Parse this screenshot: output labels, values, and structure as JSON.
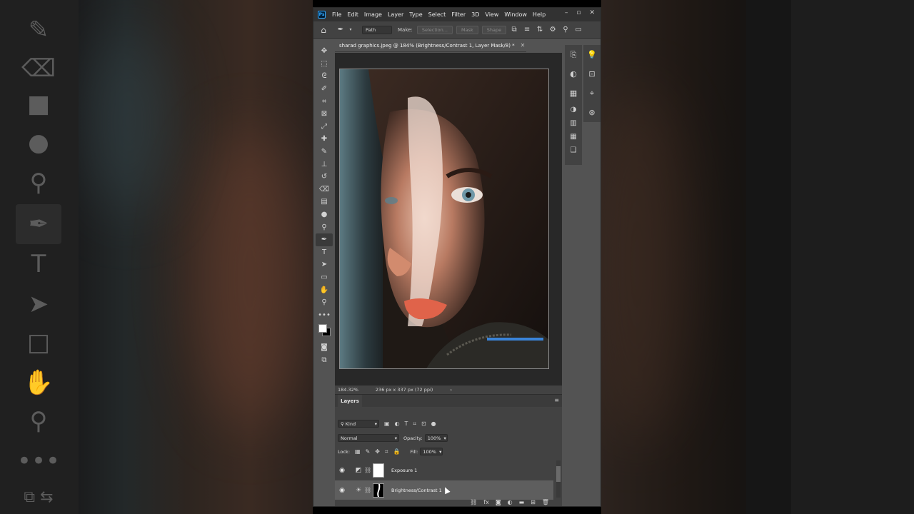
{
  "app": {
    "logo": "Ps",
    "menu": [
      "File",
      "Edit",
      "Image",
      "Layer",
      "Type",
      "Select",
      "Filter",
      "3D",
      "View",
      "Window",
      "Help"
    ],
    "window_controls": [
      "minimize-icon",
      "maximize-icon",
      "close-icon"
    ]
  },
  "options_bar": {
    "mode_value": "Path",
    "make_label": "Make:",
    "selection_btn": "Selection...",
    "mask_btn": "Mask",
    "shape_btn": "Shape"
  },
  "toolbar": {
    "tools": [
      "move-icon",
      "marquee-icon",
      "lasso-icon",
      "quick-select-icon",
      "crop-icon",
      "frame-icon",
      "eyedropper-icon",
      "healing-icon",
      "brush-icon",
      "stamp-icon",
      "history-brush-icon",
      "eraser-icon",
      "gradient-icon",
      "blur-icon",
      "dodge-icon",
      "pen-icon",
      "type-icon",
      "path-select-icon",
      "rectangle-icon",
      "hand-icon",
      "zoom-icon",
      "more-icon"
    ],
    "selected": "pen-icon",
    "foreground": "#ffffff",
    "background": "#000000"
  },
  "document": {
    "tab_title": "sharad graphics.jpeg @ 184% (Brightness/Contrast 1, Layer Mask/8) *",
    "zoom": "184.32%",
    "dimensions": "236 px x 337 px (72 ppi)",
    "accent_line_color": "#3a84d8"
  },
  "right_panels": {
    "column1": [
      "history-icon",
      "color-icon",
      "swatches-icon",
      "adjustments-icon",
      "gradients-icon",
      "patterns-icon",
      "libraries-icon"
    ],
    "column2": [
      "learn-icon",
      "properties-icon",
      "paths-icon",
      "channels-icon"
    ]
  },
  "layers": {
    "tab": "Layers",
    "filter_kind": "Kind",
    "blend_mode": "Normal",
    "opacity_label": "Opacity:",
    "opacity_value": "100%",
    "lock_label": "Lock:",
    "fill_label": "Fill:",
    "fill_value": "100%",
    "items": [
      {
        "name": "Exposure 1",
        "visible": true,
        "selected": false
      },
      {
        "name": "Brightness/Contrast 1",
        "visible": true,
        "selected": true
      }
    ]
  }
}
